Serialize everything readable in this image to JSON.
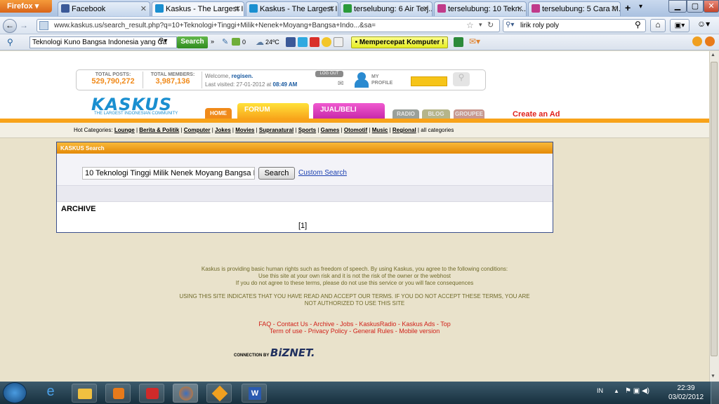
{
  "browser": {
    "menu_button": "Firefox",
    "tabs": [
      {
        "label": "Facebook",
        "color": "#3b5998"
      },
      {
        "label": "Kaskus - The Largest I...",
        "color": "#1a8fd0"
      },
      {
        "label": "Kaskus - The Largest I...",
        "color": "#1a8fd0"
      },
      {
        "label": "terselubung: 6 Air Terj...",
        "color": "#2a9a3a"
      },
      {
        "label": "terselubung: 10 Tekn...",
        "color": "#c03a8a"
      },
      {
        "label": "terselubung: 5 Cara M...",
        "color": "#c03a8a"
      }
    ],
    "new_tab": "+",
    "url": "www.kaskus.us/search_result.php?q=10+Teknologi+Tinggi+Milik+Nenek+Moyang+Bangsa+Indo...&sa=",
    "search_value": "lirik roly poly"
  },
  "toolbar": {
    "search_value": "Teknologi Kuno Bangsa Indonesia yang Ca",
    "search_button": "Search",
    "mail_count": "0",
    "weather": "24ºC",
    "speedup_button": "• Mempercepat Komputer !"
  },
  "kaskus": {
    "total_posts_label": "TOTAL POSTS:",
    "total_posts": "529,790,272",
    "total_members_label": "TOTAL MEMBERS:",
    "total_members": "3,987,136",
    "welcome": "Welcome,",
    "username": "regisen.",
    "last_visited": "Last visited: 27-01-2012 at",
    "last_visited_time": "08:49 AM",
    "logout": "LOG OUT",
    "my_profile": "MY PROFILE",
    "logo": "KASKUS",
    "logo_sub": "THE LARGEST INDONESIAN COMMUNITY",
    "nav": {
      "home": "HOME",
      "forum": "FORUM",
      "jualbeli": "JUAL/BELI",
      "radio": "RADIO",
      "blog": "BLOG",
      "groupee": "GROUPEE"
    },
    "create_ad": "Create an Ad",
    "hot_label": "Hot Categories:",
    "hot_categories": [
      "Lounge",
      "Berita & Politik",
      "Computer",
      "Jokes",
      "Movies",
      "Supranatural",
      "Sports",
      "Games",
      "Otomotif",
      "Music",
      "Regional"
    ],
    "all_categories": "all categories"
  },
  "search_panel": {
    "title": "KASKUS Search",
    "query": "10 Teknologi Tinggi Milik Nenek Moyang Bangsa I",
    "search_button": "Search",
    "custom_search": "Custom Search",
    "archive": "ARCHIVE",
    "page": "[1]"
  },
  "footer": {
    "line1": "Kaskus is providing basic human rights such as freedom of speech. By using Kaskus, you agree to the following conditions:",
    "line2": "Use this site at your own risk and it is not the risk of the owner or the webhost",
    "line3": "If you do not agree to these terms, please do not use this service or you will face consequences",
    "line4": "USING THIS SITE INDICATES THAT YOU HAVE READ AND ACCEPT OUR TERMS. IF YOU DO NOT ACCEPT THESE TERMS, YOU ARE",
    "line5": "NOT AUTHORIZED TO USE THIS SITE",
    "links1": "FAQ - Contact Us - Archive - Jobs - KaskusRadio - Kaskus Ads - Top",
    "links2": "Term of use - Privacy Policy - General Rules - Mobile version",
    "connection": "CONNECTION BY",
    "biznet": "BiZNET."
  },
  "taskbar": {
    "lang": "IN",
    "time": "22:39",
    "date": "03/02/2012"
  }
}
